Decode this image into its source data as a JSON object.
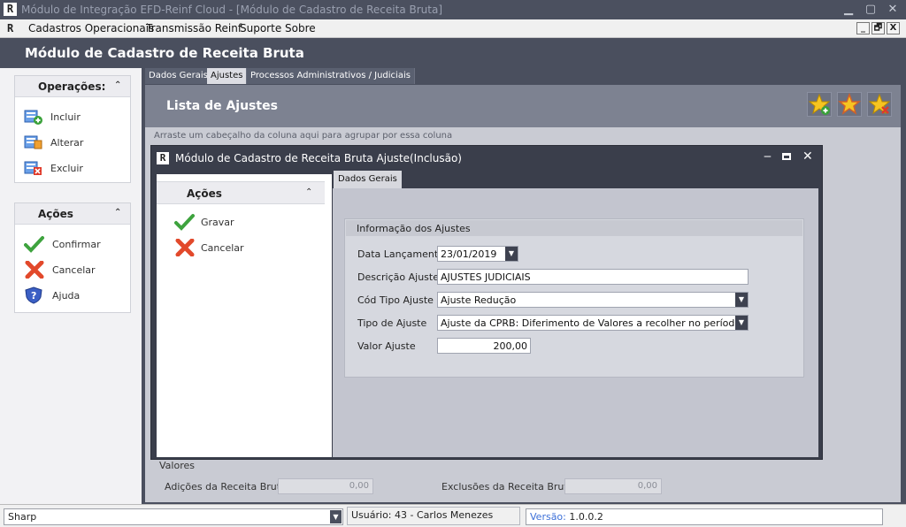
{
  "app": {
    "window_title": "Módulo de Integração EFD-Reinf Cloud - [Módulo de Cadastro de Receita Bruta]",
    "logo_letter": "R"
  },
  "menu": {
    "items": [
      "Cadastros Operacionais",
      "Transmissão Reinf",
      "Suporte",
      "Sobre"
    ],
    "mdi_buttons": [
      "_",
      "🗗",
      "X"
    ]
  },
  "header": {
    "title": "Módulo de Cadastro de Receita Bruta"
  },
  "left_panel": {
    "operacoes": {
      "title": "Operações:",
      "items": [
        {
          "label": "Incluir",
          "icon": "add-record-icon"
        },
        {
          "label": "Alterar",
          "icon": "edit-record-icon"
        },
        {
          "label": "Excluir",
          "icon": "delete-record-icon"
        }
      ]
    },
    "acoes": {
      "title": "Ações",
      "items": [
        {
          "label": "Confirmar",
          "icon": "checkmark-icon"
        },
        {
          "label": "Cancelar",
          "icon": "x-cancel-icon"
        },
        {
          "label": "Ajuda",
          "icon": "help-shield-icon"
        }
      ]
    }
  },
  "main": {
    "tabs": [
      "Dados Gerais",
      "Ajustes",
      "Processos Administrativos / Judiciais"
    ],
    "active_tab": "Ajustes",
    "list_title": "Lista de Ajustes",
    "group_hint": "Arraste um cabeçalho da coluna aqui para agrupar por essa coluna",
    "valores": {
      "title": "Valores",
      "adicoes_label": "Adições da Receita Bruta:",
      "adicoes_value": "0,00",
      "exclusoes_label": "Exclusões da Receita Bruta:",
      "exclusoes_value": "0,00"
    }
  },
  "dialog": {
    "title": "Módulo de Cadastro de Receita Bruta Ajuste",
    "mode": "(Inclusão)",
    "acoes": {
      "title": "Ações",
      "items": [
        {
          "label": "Gravar",
          "icon": "checkmark-icon"
        },
        {
          "label": "Cancelar",
          "icon": "x-cancel-icon"
        }
      ]
    },
    "tab": "Dados Gerais",
    "group_title": "Informação dos Ajustes",
    "fields": {
      "data_lancamento": {
        "label": "Data Lançamento",
        "value": "23/01/2019"
      },
      "descricao": {
        "label": "Descrição Ajuste",
        "value": "AJUSTES JUDICIAIS"
      },
      "cod_tipo": {
        "label": "Cód Tipo Ajuste",
        "value": "Ajuste Redução"
      },
      "tipo": {
        "label": "Tipo de Ajuste",
        "value": "Ajuste da CPRB: Diferimento de Valores a recolher no período"
      },
      "valor": {
        "label": "Valor Ajuste",
        "value": "200,00"
      }
    }
  },
  "status": {
    "combo_value": "Sharp",
    "usuario": "Usuário: 43 - Carlos Menezes",
    "versao_label": "Versão:",
    "versao_value": "1.0.0.2"
  },
  "colors": {
    "dark_chrome": "#4a4f5e",
    "accent_blue": "#3b6fd8",
    "confirm_green": "#4caf50",
    "cancel_red": "#e2492b"
  }
}
